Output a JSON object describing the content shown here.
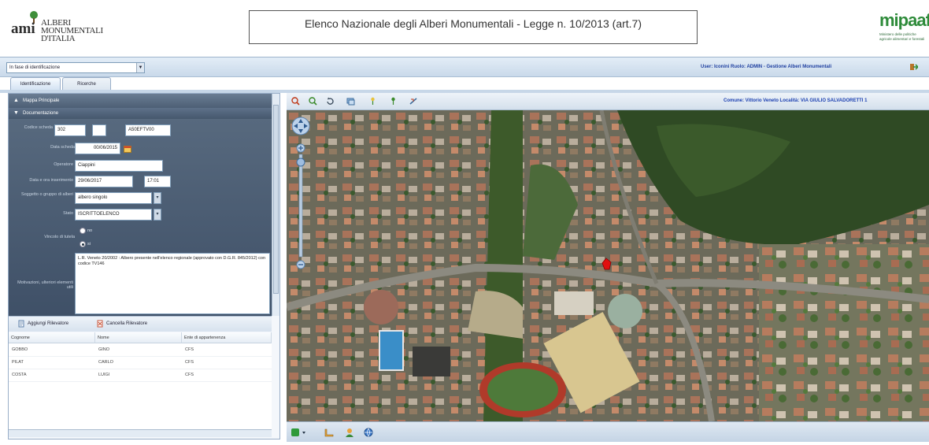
{
  "header": {
    "logo_mark": "ami",
    "logo_lines": [
      "ALBERI",
      "MONUMENTALI",
      "D'ITALIA"
    ],
    "title": "Elenco Nazionale degli Alberi Monumentali - Legge n. 10/2013 (art.7)",
    "ministry_logo": "mipaaf",
    "ministry_sub": "Ministero delle politiche agricole alimentari e forestali"
  },
  "topbar": {
    "select_value": "In fase di identificazione",
    "user_info": "User: Iconini Ruolo: ADMIN - Gestione Alberi Monumentali"
  },
  "tabs": [
    "Identificazione",
    "Ricerche"
  ],
  "left": {
    "mappa_header": "Mappa Principale",
    "doc_header": "Documentazione",
    "fields": {
      "codice_label": "Codice scheda",
      "codice_a": "302",
      "codice_b": "",
      "codice_c": "A50EFTV00",
      "data_label": "Data scheda",
      "data_value": "00/06/2015",
      "operatore_label": "Operatore",
      "operatore_value": "Ciappini",
      "ultima_label": "Data e ora inserimento",
      "ultima_date": "29/06/2017",
      "ultima_time": "17:01",
      "soggetto_label": "Soggetto o gruppo di alberi",
      "soggetto_value": "albero singolo",
      "stato_label": "Stato",
      "stato_value": "ISCRITTOELENCO",
      "vincolo_label": "Vincolo di tutela",
      "radio_no": "no",
      "radio_si": "si",
      "note_label": "Motivazioni, ulteriori elementi utili",
      "note_value": "L.R. Veneto 20/2002 : Albero presente nell'elenco regionale (approvato con D.G.R. 845/2012) con codice TV146"
    },
    "ril_add": "Aggiungi Rilevatore",
    "ril_del": "Cancella Rilevatore",
    "table_headers": [
      "Cognome",
      "Nome",
      "Ente di appartenenza"
    ],
    "rows": [
      [
        "GOBBO",
        "GINO",
        "CFS"
      ],
      [
        "PILAT",
        "CARLO",
        "CFS"
      ],
      [
        "COSTA",
        "LUIGI",
        "CFS"
      ]
    ]
  },
  "map": {
    "comune_label": "Comune: Vittorio Veneto Località: VIA GIULIO SALVADORETTI 1",
    "icons": [
      "zoom-in-icon",
      "zoom-extent-icon",
      "refresh-icon",
      "layers-icon",
      "pin-icon",
      "pin-add-icon",
      "measure-icon"
    ],
    "colors": {
      "marker": "#e01010",
      "road": "#8c8a80"
    }
  }
}
